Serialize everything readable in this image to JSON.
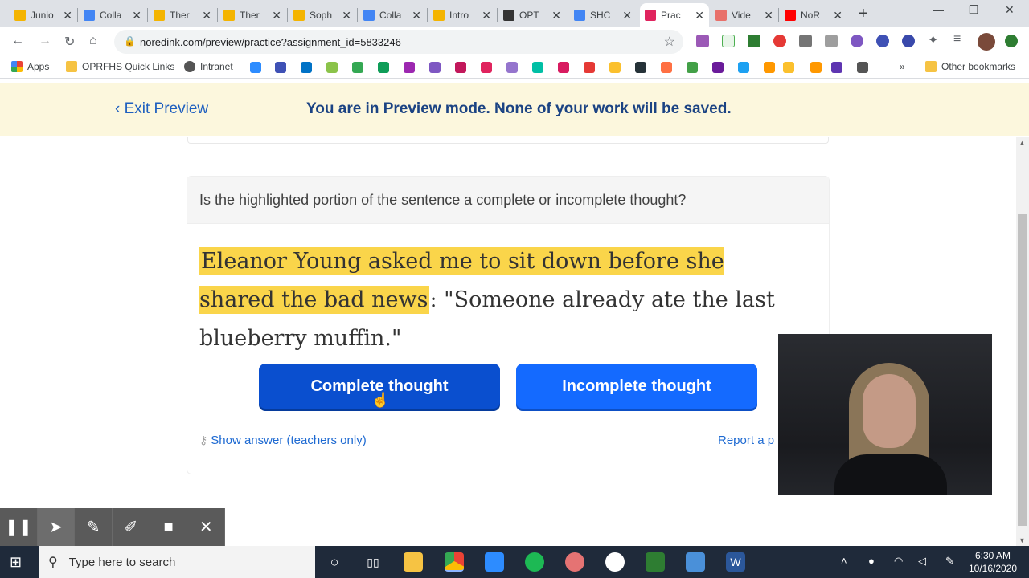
{
  "browser": {
    "tabs": [
      {
        "title": "Junio",
        "color": "#f4b400"
      },
      {
        "title": "Colla",
        "color": "#4285f4"
      },
      {
        "title": "Ther",
        "color": "#f4b400"
      },
      {
        "title": "Ther",
        "color": "#f4b400"
      },
      {
        "title": "Soph",
        "color": "#f4b400"
      },
      {
        "title": "Colla",
        "color": "#4285f4"
      },
      {
        "title": "Intro",
        "color": "#f4b400"
      },
      {
        "title": "OPT",
        "color": "#333333"
      },
      {
        "title": "SHC",
        "color": "#4285f4"
      },
      {
        "title": "Prac",
        "color": "#e0245e"
      },
      {
        "title": "Vide",
        "color": "#e8706a"
      },
      {
        "title": "NoR",
        "color": "#ff0000"
      }
    ],
    "url": "noredink.com/preview/practice?assignment_id=5833246",
    "bookmarks": {
      "apps": "Apps",
      "quick_links": "OPRFHS Quick Links",
      "intranet": "Intranet",
      "more": "»",
      "other": "Other bookmarks"
    }
  },
  "banner": {
    "exit": "Exit Preview",
    "message": "You are in Preview mode. None of your work will be saved."
  },
  "question": {
    "prompt": "Is the highlighted portion of the sentence a complete or incomplete thought?",
    "highlighted": "Eleanor Young asked me to sit down before she shared the bad news",
    "rest": ": \"Someone already ate the last blueberry muffin.\"",
    "buttons": {
      "complete": "Complete thought",
      "incomplete": "Incomplete thought"
    },
    "show_answer": "Show answer (teachers only)",
    "report": "Report a p"
  },
  "taskbar": {
    "search_placeholder": "Type here to search",
    "time": "6:30 AM",
    "date": "10/16/2020"
  }
}
